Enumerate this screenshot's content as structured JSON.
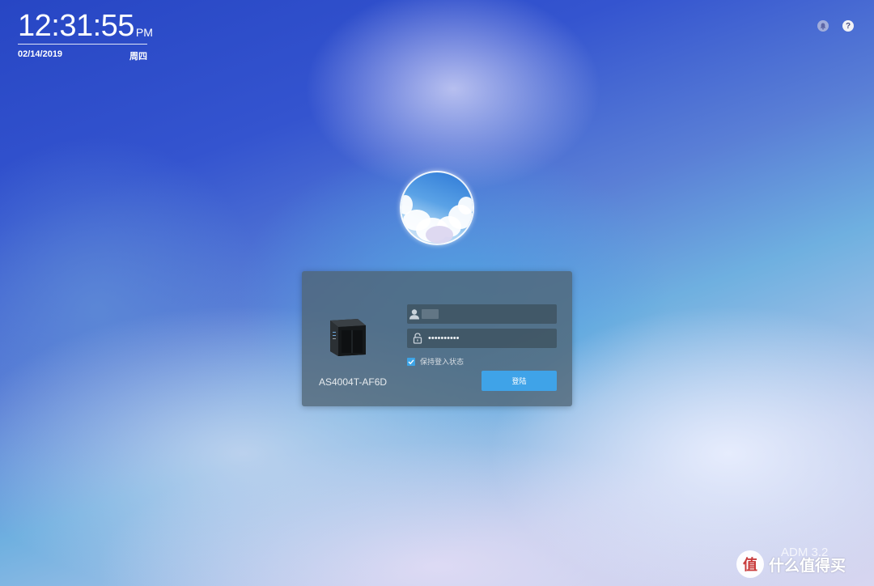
{
  "clock": {
    "time": "12:31:55",
    "ampm": "PM",
    "date": "02/14/2019",
    "weekday": "周四"
  },
  "topbar": {
    "notification_icon": "bell-icon",
    "help_icon": "help-icon",
    "help_glyph": "?"
  },
  "login": {
    "device_name": "AS4004T-AF6D",
    "username_value": "",
    "password_value": "••••••••••",
    "remember_label": "保持登入状态",
    "remember_checked": true,
    "login_button_label": "登陆",
    "accent_color": "#3fa3e8"
  },
  "footer": {
    "version": "ADM 3.2",
    "watermark_text": "什么值得买",
    "watermark_logo_glyph": "值"
  }
}
